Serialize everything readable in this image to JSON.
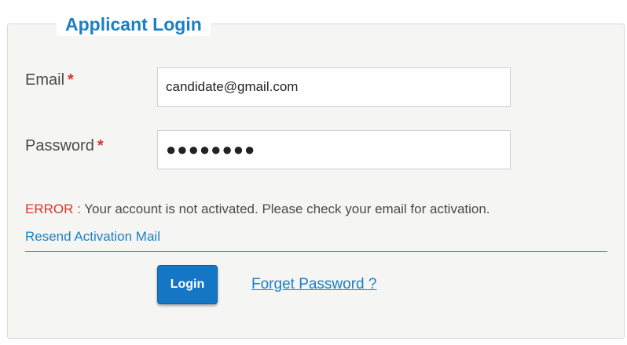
{
  "form": {
    "title": "Applicant Login",
    "email": {
      "label": "Email",
      "required_mark": "*",
      "value": "candidate@gmail.com"
    },
    "password": {
      "label": "Password",
      "required_mark": "*",
      "masked_value": "●●●●●●●●"
    },
    "error": {
      "label": "ERROR :",
      "message": "Your account is not activated. Please check your email for activation."
    },
    "resend_link": "Resend Activation Mail",
    "login_button": "Login",
    "forget_link": "Forget Password ?"
  },
  "colors": {
    "accent": "#1c7fc4",
    "button": "#1476c5",
    "error": "#d9362b"
  }
}
